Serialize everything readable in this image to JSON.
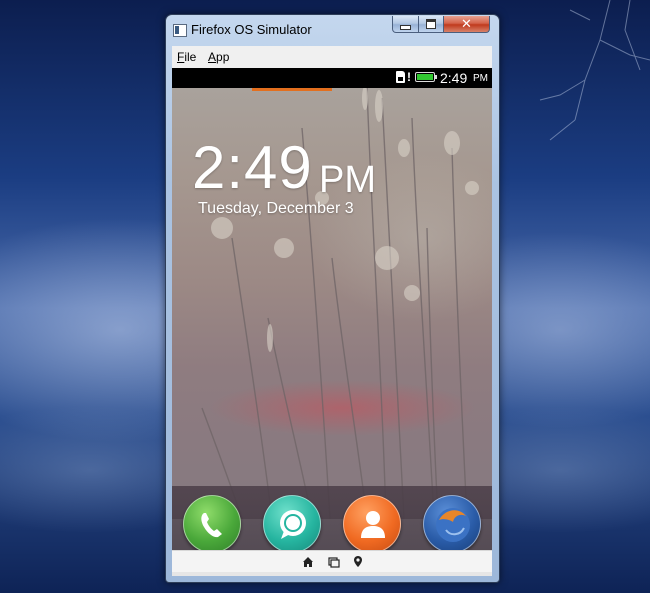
{
  "window": {
    "title": "Firefox OS Simulator",
    "buttons": {
      "minimize": "",
      "maximize": "",
      "close": "✕"
    }
  },
  "menubar": {
    "items": [
      {
        "label": "File",
        "accel": "F",
        "rest": "ile"
      },
      {
        "label": "App",
        "accel": "A",
        "rest": "pp"
      }
    ]
  },
  "statusbar": {
    "time": "2:49",
    "ampm": "PM",
    "alert": "!",
    "icons": [
      "sim-card-icon",
      "battery-icon"
    ]
  },
  "lockscreen": {
    "time": "2:49",
    "ampm": "PM",
    "date": "Tuesday, December 3"
  },
  "dock": {
    "apps": [
      {
        "name": "phone",
        "icon": "phone-icon"
      },
      {
        "name": "messages",
        "icon": "message-bubble-icon"
      },
      {
        "name": "contacts",
        "icon": "contact-person-icon"
      },
      {
        "name": "browser",
        "icon": "firefox-globe-icon"
      }
    ]
  },
  "navbar": {
    "icons": [
      "home-icon",
      "windows-icon",
      "location-pin-icon"
    ]
  },
  "colors": {
    "accent_orange": "#e36f1e",
    "battery_green": "#32c832",
    "close_red": "#c03a1e"
  }
}
